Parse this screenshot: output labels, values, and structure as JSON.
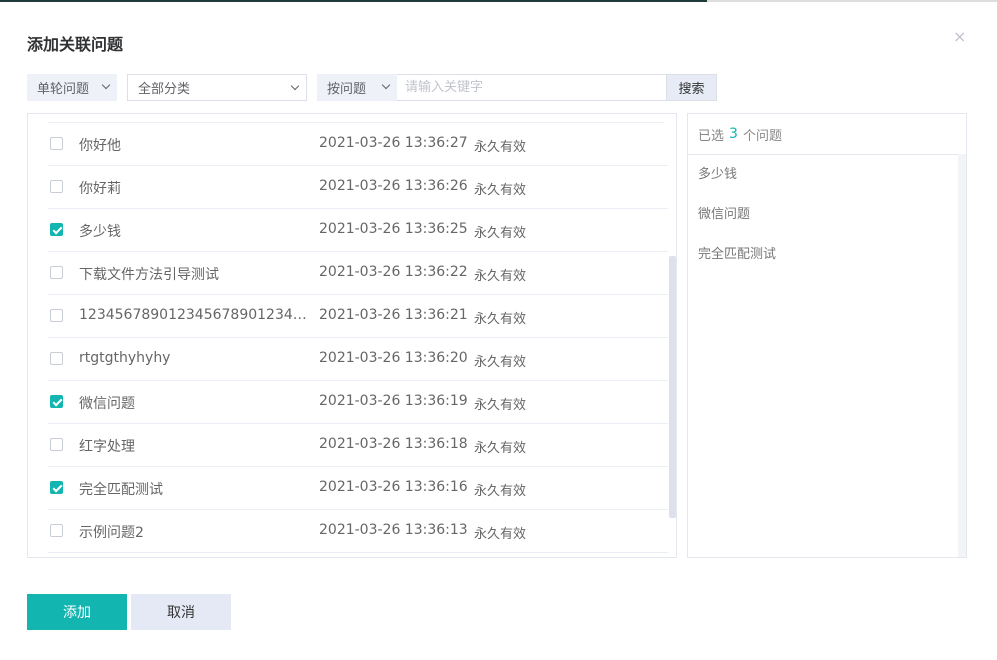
{
  "dialog": {
    "title": "添加关联问题",
    "close_symbol": "×"
  },
  "filters": {
    "question_type": "单轮问题",
    "category": "全部分类",
    "search_mode": "按问题",
    "search_placeholder": "请输入关键字",
    "search_value": "",
    "search_button": "搜索"
  },
  "rows": [
    {
      "question": "你好他",
      "time": "2021-03-26 13:36:27",
      "validity": "永久有效",
      "checked": false
    },
    {
      "question": "你好莉",
      "time": "2021-03-26 13:36:26",
      "validity": "永久有效",
      "checked": false
    },
    {
      "question": "多少钱",
      "time": "2021-03-26 13:36:25",
      "validity": "永久有效",
      "checked": true
    },
    {
      "question": "下载文件方法引导测试",
      "time": "2021-03-26 13:36:22",
      "validity": "永久有效",
      "checked": false
    },
    {
      "question": "12345678901234567890123456...",
      "time": "2021-03-26 13:36:21",
      "validity": "永久有效",
      "checked": false
    },
    {
      "question": "rtgtgthyhyhy",
      "time": "2021-03-26 13:36:20",
      "validity": "永久有效",
      "checked": false
    },
    {
      "question": "微信问题",
      "time": "2021-03-26 13:36:19",
      "validity": "永久有效",
      "checked": true
    },
    {
      "question": "红字处理",
      "time": "2021-03-26 13:36:18",
      "validity": "永久有效",
      "checked": false
    },
    {
      "question": "完全匹配测试",
      "time": "2021-03-26 13:36:16",
      "validity": "永久有效",
      "checked": true
    },
    {
      "question": "示例问题2",
      "time": "2021-03-26 13:36:13",
      "validity": "永久有效",
      "checked": false
    }
  ],
  "selected": {
    "prefix": "已选",
    "count": "3",
    "suffix": "个问题",
    "items": [
      "多少钱",
      "微信问题",
      "完全匹配测试"
    ]
  },
  "buttons": {
    "add": "添加",
    "cancel": "取消"
  },
  "colors": {
    "accent": "#13b5b1",
    "cancel_bg": "#e4e9f5",
    "filter_bg": "#eef1f8"
  }
}
